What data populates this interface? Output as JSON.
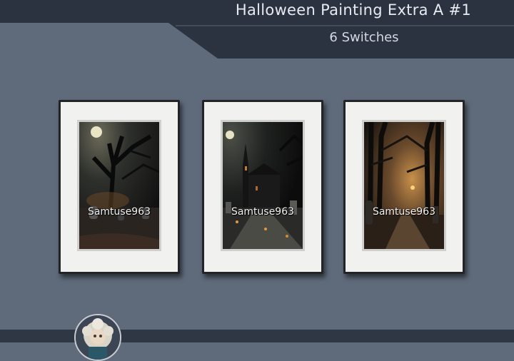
{
  "header": {
    "title": "Halloween Painting Extra A #1",
    "subtitle": "6 Switches"
  },
  "paintings": [
    {
      "watermark": "Samtuse963",
      "scene": "moonlit-forest-graveyard"
    },
    {
      "watermark": "Samtuse963",
      "scene": "church-graveyard"
    },
    {
      "watermark": "Samtuse963",
      "scene": "glowing-forest-path"
    }
  ],
  "colors": {
    "background": "#5f6b7b",
    "banner": "#2b3340",
    "frame": "#232428",
    "mat": "#f1f1ef"
  }
}
